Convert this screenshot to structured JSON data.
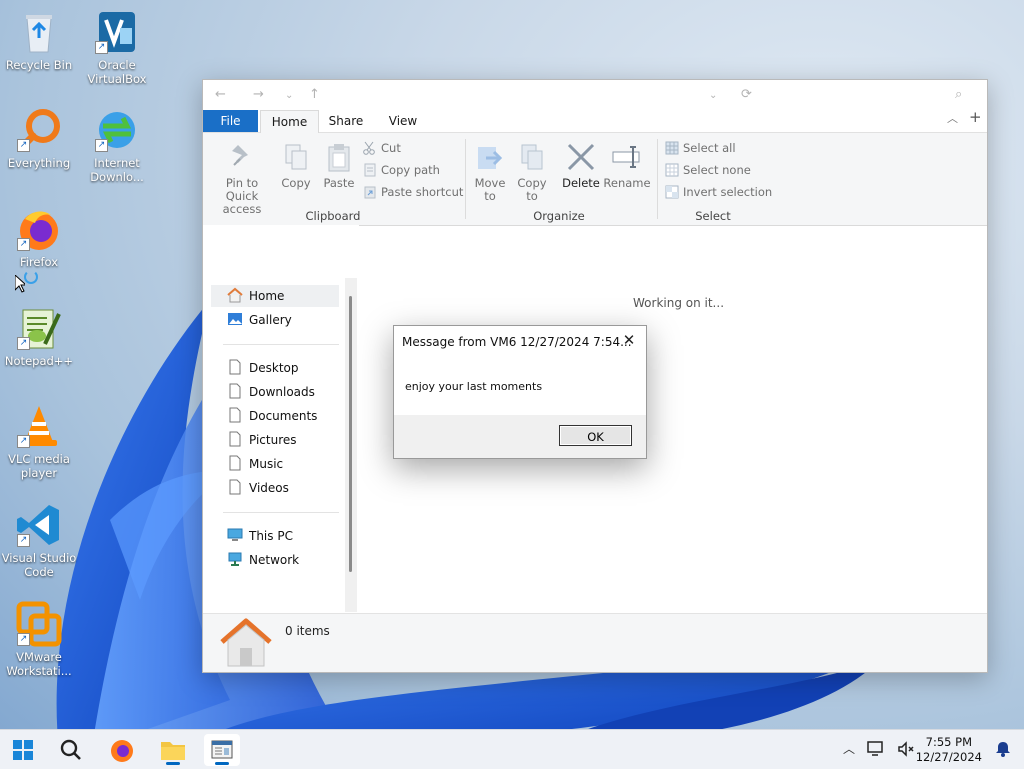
{
  "desktop": {
    "icons": [
      {
        "label": "Recycle Bin",
        "icon": "recycle-bin-icon"
      },
      {
        "label": "Oracle VirtualBox",
        "icon": "virtualbox-icon"
      },
      {
        "label": "Everything",
        "icon": "everything-search-icon"
      },
      {
        "label": "Internet Downlo...",
        "icon": "internet-download-manager-icon"
      },
      {
        "label": "Firefox",
        "icon": "firefox-icon"
      },
      {
        "label": "Notepad++",
        "icon": "notepad-plus-plus-icon"
      },
      {
        "label": "VLC media player",
        "icon": "vlc-icon"
      },
      {
        "label": "Visual Studio Code",
        "icon": "vscode-icon"
      },
      {
        "label": "VMware Workstati...",
        "icon": "vmware-icon"
      }
    ]
  },
  "explorer": {
    "tabs": {
      "file": "File",
      "home": "Home",
      "share": "Share",
      "view": "View"
    },
    "clipboard": {
      "group": "Clipboard",
      "pin": "Pin to Quick access",
      "copy": "Copy",
      "paste": "Paste",
      "cut": "Cut",
      "copy_path": "Copy path",
      "paste_shortcut": "Paste shortcut"
    },
    "organize": {
      "group": "Organize",
      "move_to": "Move to",
      "copy_to": "Copy to",
      "delete": "Delete",
      "rename": "Rename"
    },
    "select": {
      "group": "Select",
      "select_all": "Select all",
      "select_none": "Select none",
      "invert": "Invert selection"
    },
    "nav": {
      "home": "Home",
      "gallery": "Gallery",
      "desktop": "Desktop",
      "downloads": "Downloads",
      "documents": "Documents",
      "pictures": "Pictures",
      "music": "Music",
      "videos": "Videos",
      "this_pc": "This PC",
      "network": "Network"
    },
    "content_status": "Working on it...",
    "item_count": "0 items"
  },
  "dialog": {
    "title": "Message from VM6 12/27/2024 7:54...",
    "message": "enjoy your last moments",
    "ok_label": "OK"
  },
  "taskbar": {
    "time": "7:55 PM",
    "date": "12/27/2024"
  },
  "colors": {
    "accent": "#1a6fc7",
    "wallpaper_blue": "#1f5fd0"
  }
}
